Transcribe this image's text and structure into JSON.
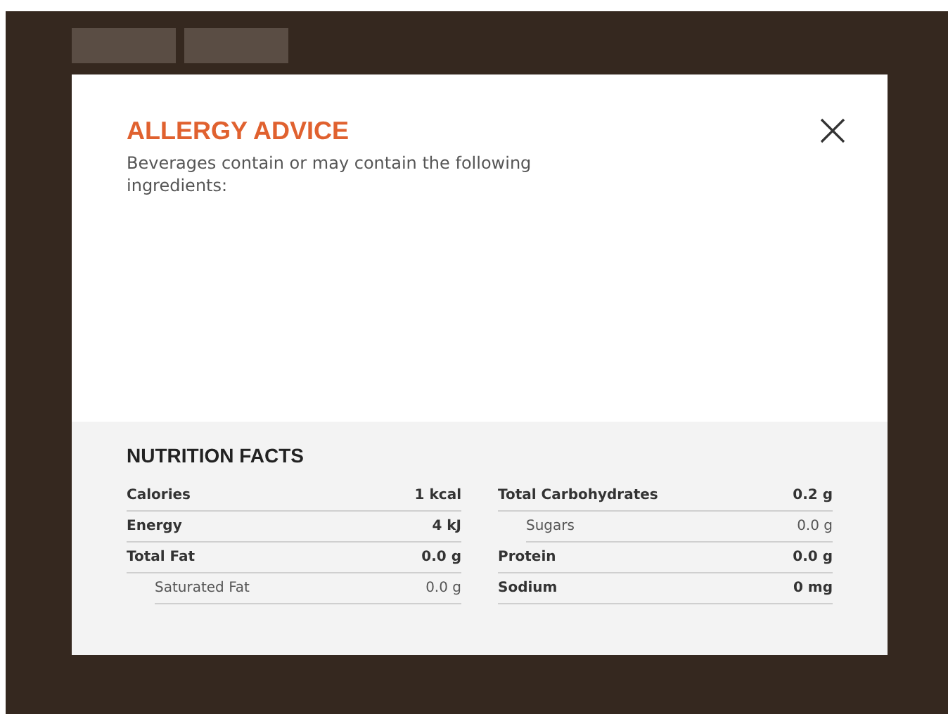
{
  "allergy": {
    "title": "ALLERGY ADVICE",
    "description": "Beverages contain or may contain the following ingredients:"
  },
  "nutrition": {
    "title": "NUTRITION FACTS",
    "columns": [
      {
        "rows": [
          {
            "label": "Calories",
            "value": "1 kcal",
            "indented": false
          },
          {
            "label": "Energy",
            "value": "4 kJ",
            "indented": false
          },
          {
            "label": "Total Fat",
            "value": "0.0 g",
            "indented": false
          },
          {
            "label": "Saturated Fat",
            "value": "0.0 g",
            "indented": true
          }
        ]
      },
      {
        "rows": [
          {
            "label": "Total Carbohydrates",
            "value": "0.2 g",
            "indented": false
          },
          {
            "label": "Sugars",
            "value": "0.0 g",
            "indented": true
          },
          {
            "label": "Protein",
            "value": "0.0 g",
            "indented": false
          },
          {
            "label": "Sodium",
            "value": "0 mg",
            "indented": false
          }
        ]
      }
    ]
  }
}
